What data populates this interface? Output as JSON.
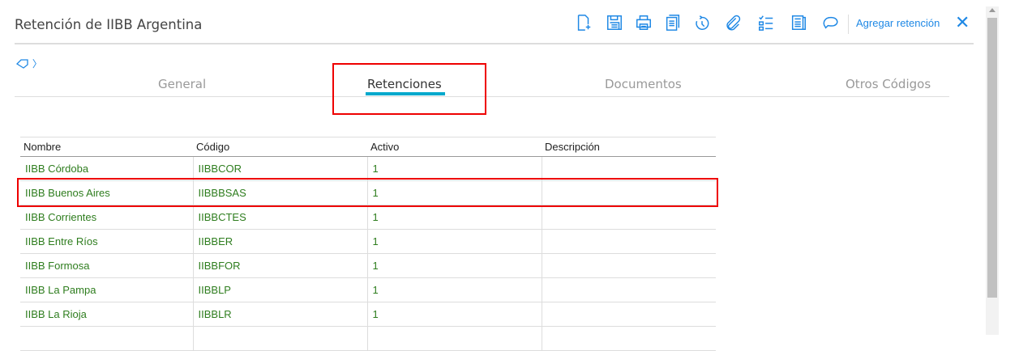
{
  "header": {
    "title": "Retención de IIBB Argentina",
    "add_label": "Agregar retención",
    "close": "✕",
    "toolbar_icons": [
      "new-document-icon",
      "save-icon",
      "print-icon",
      "copy-icon",
      "history-icon",
      "attachment-icon",
      "checklist-icon",
      "report-icon",
      "comment-icon"
    ]
  },
  "breadcrumb": {
    "chevron": "〉"
  },
  "tabs": [
    "General",
    "Retenciones",
    "Documentos",
    "Otros Códigos"
  ],
  "table": {
    "headers": [
      "Nombre",
      "Código",
      "Activo",
      "Descripción"
    ],
    "rows": [
      [
        "IIBB Córdoba",
        "IIBBCOR",
        "1",
        ""
      ],
      [
        "IIBB Buenos Aires",
        "IIBBBSAS",
        "1",
        ""
      ],
      [
        "IIBB Corrientes",
        "IIBBCTES",
        "1",
        ""
      ],
      [
        "IIBB Entre Ríos",
        "IIBBER",
        "1",
        ""
      ],
      [
        "IIBB Formosa",
        "IIBBFOR",
        "1",
        ""
      ],
      [
        "IIBB La Pampa",
        "IIBBLP",
        "1",
        ""
      ],
      [
        "IIBB La Rioja",
        "IIBBLR",
        "1",
        ""
      ],
      [
        "",
        "",
        "",
        ""
      ]
    ]
  }
}
